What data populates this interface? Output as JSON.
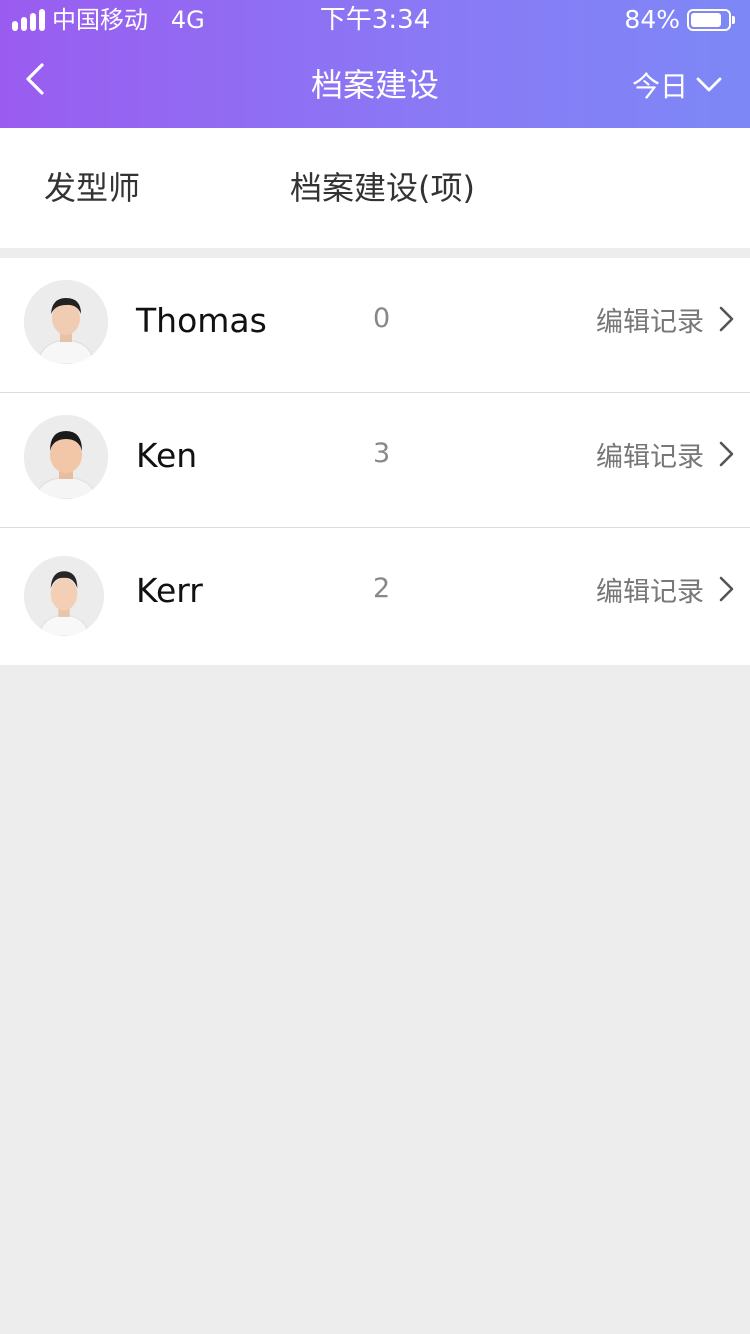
{
  "status_bar": {
    "carrier": "中国移动   4G",
    "time": "下午3:34",
    "battery_pct": "84%",
    "battery_level": 0.84
  },
  "nav": {
    "back_icon": "chevron-left-icon",
    "title": "档案建设",
    "date_filter": "今日",
    "date_filter_icon": "chevron-down-icon"
  },
  "columns": {
    "stylist": "发型师",
    "archive_count": "档案建设(项)"
  },
  "rows": [
    {
      "name": "Thomas",
      "count": "0",
      "action": "编辑记录"
    },
    {
      "name": "Ken",
      "count": "3",
      "action": "编辑记录"
    },
    {
      "name": "Kerr",
      "count": "2",
      "action": "编辑记录"
    }
  ],
  "colors": {
    "header_gradient_start": "#9a5cf0",
    "header_gradient_end": "#7d88f6",
    "page_background": "#ededed"
  }
}
